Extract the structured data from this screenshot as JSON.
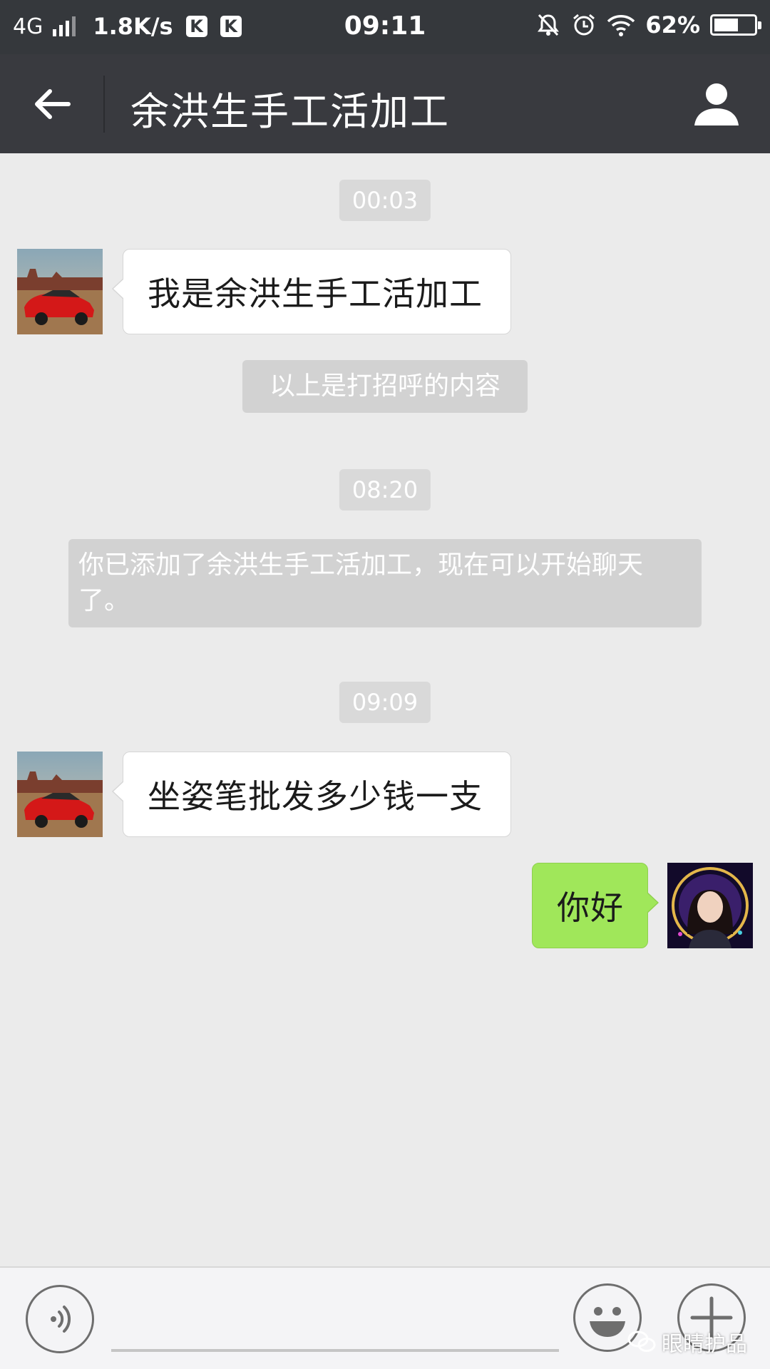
{
  "status_bar": {
    "network": "4G",
    "speed": "1.8K/s",
    "badges": [
      "K",
      "K"
    ],
    "time": "09:11",
    "battery_percent": "62%",
    "battery_level": 0.62,
    "icons": [
      "signal-icon",
      "mute-bell-icon",
      "alarm-icon",
      "wifi-icon",
      "battery-icon"
    ]
  },
  "header": {
    "title": "余洪生手工活加工",
    "back_icon": "arrow-left-icon",
    "profile_icon": "person-icon"
  },
  "messages": [
    {
      "type": "time",
      "text": "00:03"
    },
    {
      "type": "incoming",
      "text": "我是余洪生手工活加工",
      "avatar": "red-car-avatar"
    },
    {
      "type": "system",
      "text": "以上是打招呼的内容"
    },
    {
      "type": "time",
      "text": "08:20"
    },
    {
      "type": "system",
      "text": "你已添加了余洪生手工活加工，现在可以开始聊天了。"
    },
    {
      "type": "time",
      "text": "09:09"
    },
    {
      "type": "incoming",
      "text": "坐姿笔批发多少钱一支",
      "avatar": "red-car-avatar"
    },
    {
      "type": "outgoing",
      "text": "你好",
      "avatar": "woman-portrait-avatar"
    }
  ],
  "input_bar": {
    "voice_icon": "voice-icon",
    "emoji_icon": "emoji-icon",
    "plus_icon": "plus-icon",
    "input_value": ""
  },
  "watermark": {
    "text": "眼睛护品",
    "icon": "wechat-icon"
  },
  "colors": {
    "status_bar": "#35383c",
    "title_bar": "#393a3f",
    "chat_bg": "#ebebeb",
    "outgoing_bubble": "#a0e75a",
    "incoming_bubble": "#ffffff"
  }
}
